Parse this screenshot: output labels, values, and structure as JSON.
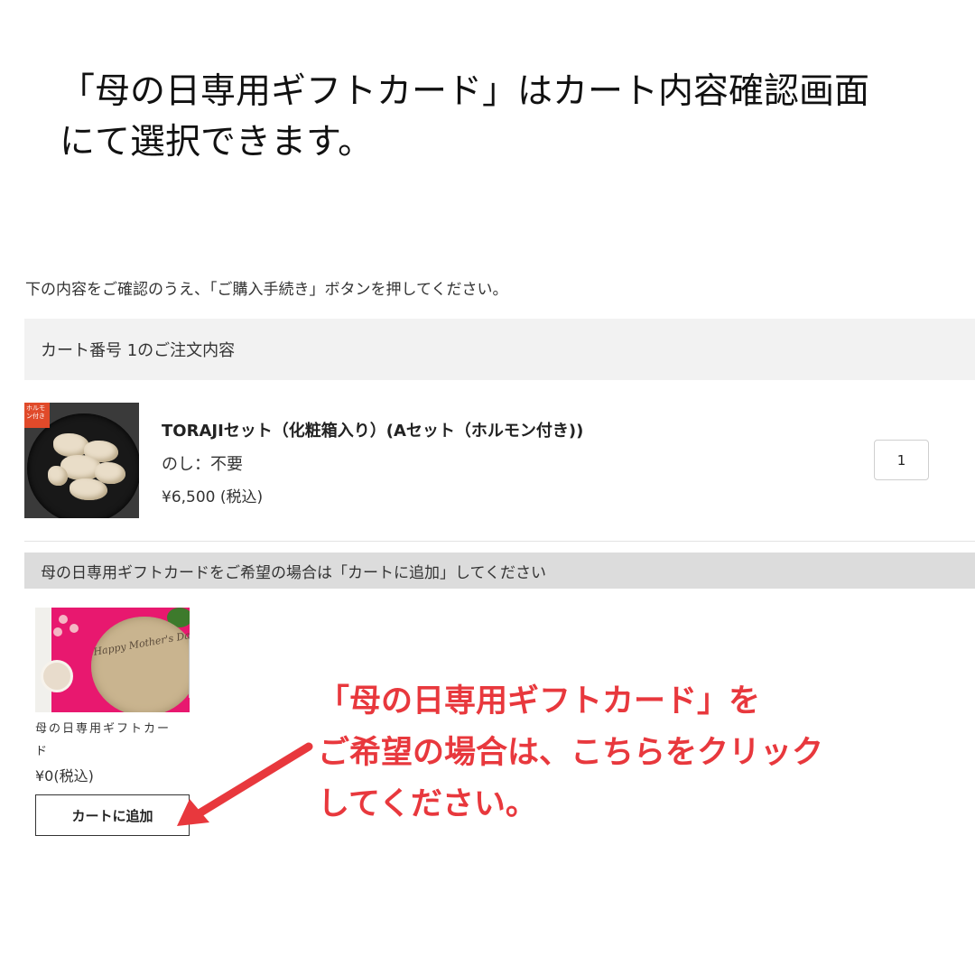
{
  "headline": {
    "line1": "「母の日専用ギフトカード」はカート内容確認画面",
    "line2": "にて選択できます。"
  },
  "instruction": "下の内容をご確認のうえ、「ご購入手続き」ボタンを押してください。",
  "cart": {
    "header": "カート番号 1のご注文内容",
    "item": {
      "tag": "ホルモン付き",
      "name": "TORAJIセット（化粧箱入り）(Aセット（ホルモン付き))",
      "noshi": "のし：不要",
      "price": "¥6,500 (税込)",
      "quantity": "1"
    }
  },
  "gift": {
    "header": "母の日専用ギフトカードをご希望の場合は「カートに追加」してください",
    "card": {
      "image_text": "Happy Mother's Day",
      "name": "母の日専用ギフトカード",
      "price": "¥0(税込)",
      "add_button": "カートに追加"
    }
  },
  "callout": {
    "line1": "「母の日専用ギフトカード」を",
    "line2": "ご希望の場合は、こちらをクリック",
    "line3": "してください。"
  },
  "colors": {
    "callout": "#e8383d",
    "header_bg": "#f2f2f2",
    "gift_header_bg": "#dcdcdc"
  }
}
